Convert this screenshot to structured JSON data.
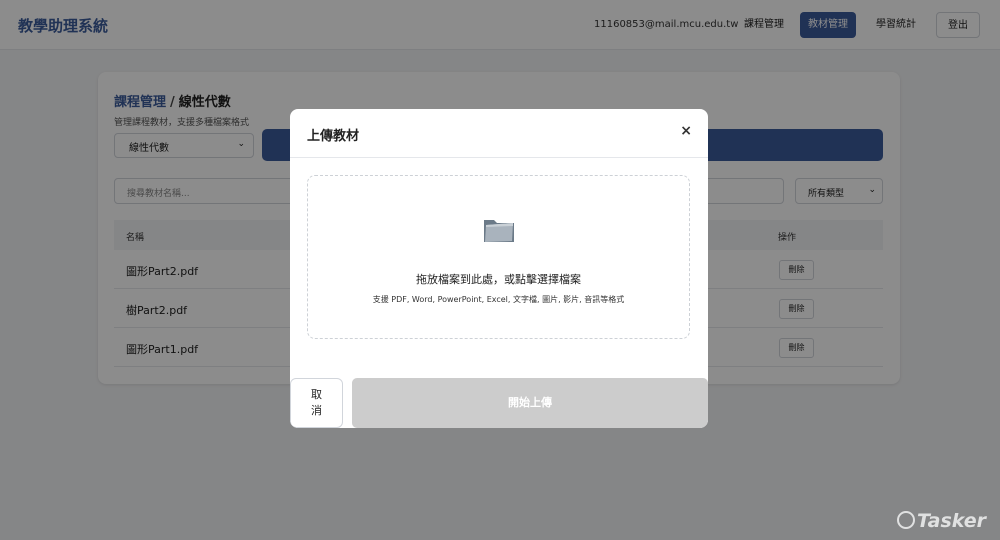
{
  "header": {
    "brand": "教學助理系統",
    "user_email": "11160853@mail.mcu.edu.tw",
    "nav": {
      "courses": "課程管理",
      "materials": "教材管理",
      "stats": "學習統計",
      "logout": "登出"
    }
  },
  "breadcrumb": {
    "link": "課程管理",
    "separator": "/",
    "current": "線性代數"
  },
  "subtitle": "管理課程教材，支援多種檔案格式",
  "course_select": {
    "value": "線性代數"
  },
  "search": {
    "placeholder": "搜尋教材名稱..."
  },
  "type_filter": {
    "value": "所有類型"
  },
  "table": {
    "headers": {
      "name": "名稱",
      "ops": "操作"
    },
    "rows": [
      {
        "name": "圖形Part2.pdf",
        "action": "刪除"
      },
      {
        "name": "樹Part2.pdf",
        "action": "刪除"
      },
      {
        "name": "圖形Part1.pdf",
        "action": "刪除"
      }
    ]
  },
  "modal": {
    "title": "上傳教材",
    "close": "×",
    "dropzone": {
      "icon": "folder-icon",
      "main": "拖放檔案到此處，或點擊選擇檔案",
      "sub": "支援 PDF, Word, PowerPoint, Excel, 文字檔, 圖片, 影片, 音訊等格式"
    },
    "cancel": "取消",
    "upload": "開始上傳"
  },
  "colors": {
    "brand": "#3b5b9b",
    "upload_disabled": "#cccccc"
  },
  "watermark": "Tasker"
}
